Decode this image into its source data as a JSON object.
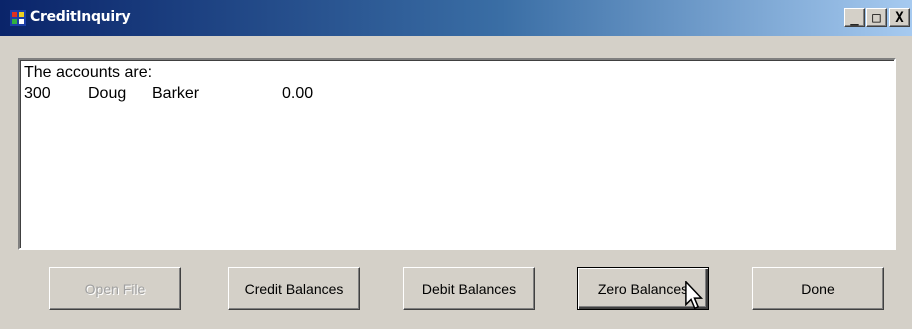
{
  "window": {
    "title": "CreditInquiry",
    "controls": {
      "minimize": "_",
      "maximize": "□",
      "close": "X"
    }
  },
  "output": {
    "heading": "The accounts are:",
    "rows": [
      {
        "account": "300",
        "first": "Doug",
        "last": "Barker",
        "balance": "0.00"
      }
    ]
  },
  "buttons": {
    "open_file": {
      "label": "Open File",
      "enabled": false
    },
    "credit_balances": {
      "label": "Credit Balances",
      "enabled": true
    },
    "debit_balances": {
      "label": "Debit Balances",
      "enabled": true
    },
    "zero_balances": {
      "label": "Zero Balances",
      "enabled": true,
      "focused": true
    },
    "done": {
      "label": "Done",
      "enabled": true
    }
  },
  "icons": {
    "app": "window-app-icon",
    "cursor": "arrow-cursor-icon"
  },
  "colors": {
    "title_bar_start": "#0a246a",
    "title_bar_end": "#a6caf0",
    "face": "#d4d0c8",
    "disabled_text": "#a0a0a0"
  }
}
